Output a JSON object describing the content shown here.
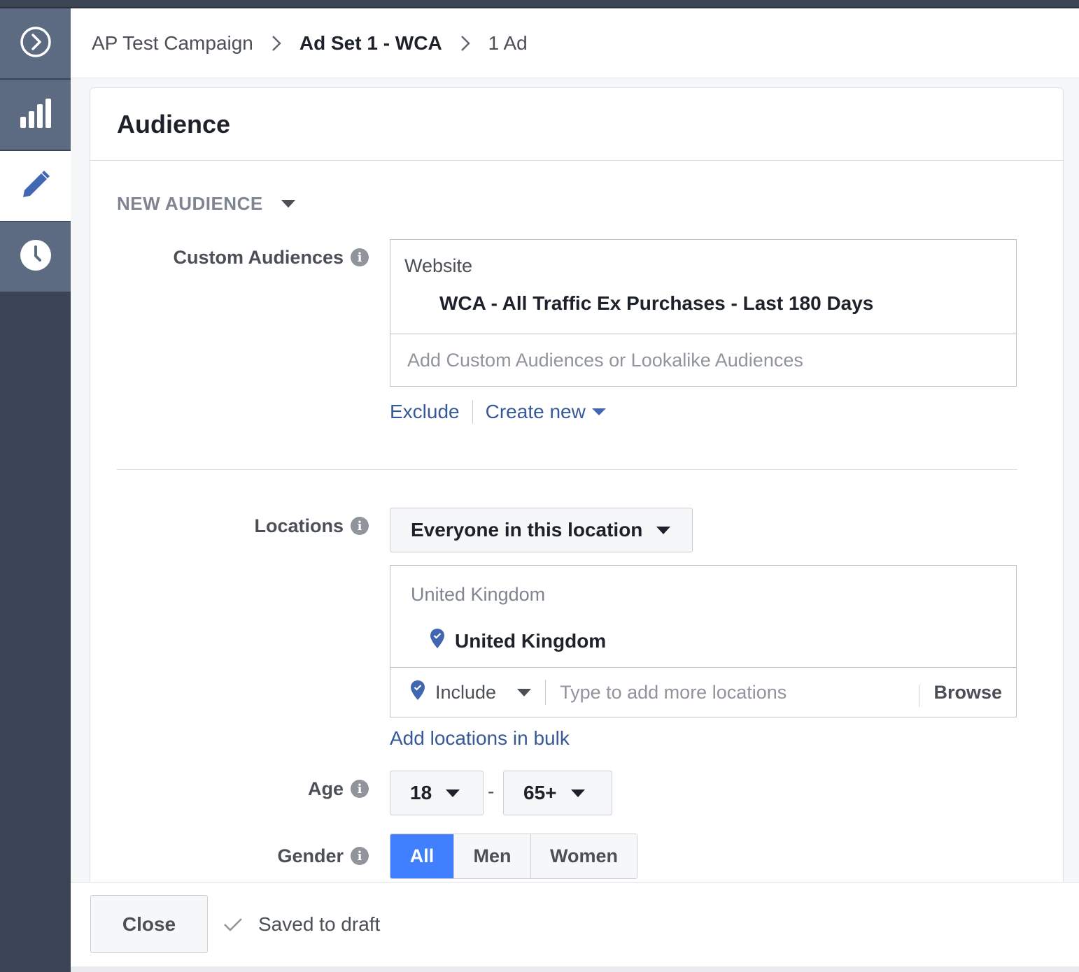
{
  "breadcrumb": {
    "campaign": "AP Test Campaign",
    "ad_set": "Ad Set 1 - WCA",
    "ad": "1 Ad"
  },
  "rail": {
    "items": [
      "expand-icon",
      "chart-icon",
      "pencil-icon",
      "clock-icon"
    ],
    "active_index": 2
  },
  "audience": {
    "title": "Audience",
    "section_toggle": "NEW AUDIENCE",
    "custom_audiences": {
      "label": "Custom Audiences",
      "category": "Website",
      "selected": "WCA - All Traffic Ex Purchases - Last 180 Days",
      "placeholder": "Add Custom Audiences or Lookalike Audiences",
      "exclude_link": "Exclude",
      "create_new_link": "Create new"
    },
    "locations": {
      "label": "Locations",
      "mode": "Everyone in this location",
      "category": "United Kingdom",
      "selected": "United Kingdom",
      "include": "Include",
      "placeholder": "Type to add more locations",
      "browse": "Browse",
      "bulk_link": "Add locations in bulk"
    },
    "age": {
      "label": "Age",
      "min": "18",
      "dash": "-",
      "max": "65+"
    },
    "gender": {
      "label": "Gender",
      "options": [
        "All",
        "Men",
        "Women"
      ],
      "selected": "All"
    }
  },
  "footer": {
    "close": "Close",
    "status": "Saved to draft"
  },
  "colors": {
    "rail_bg": "#3b4454",
    "link": "#365899",
    "gender_active": "#4080ff",
    "pin": "#4267b2"
  }
}
